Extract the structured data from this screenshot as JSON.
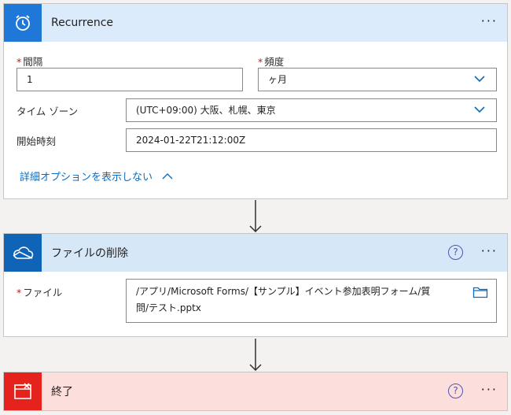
{
  "recurrence": {
    "title": "Recurrence",
    "more": "···",
    "header_color": "#dcebfc",
    "icon_bg": "#1f77d8",
    "icon": "alarm-clock-icon",
    "interval": {
      "label": "間隔",
      "value": "1"
    },
    "frequency": {
      "label": "頻度",
      "value": "ヶ月"
    },
    "timezone": {
      "label": "タイム ゾーン",
      "value": "(UTC+09:00) 大阪、札幌、東京"
    },
    "start_time": {
      "label": "開始時刻",
      "value": "2024-01-22T21:12:00Z"
    },
    "advanced_link": "詳細オプションを表示しない"
  },
  "delete_file": {
    "title": "ファイルの削除",
    "more": "···",
    "help": "?",
    "header_color": "#d6e7f7",
    "icon_bg": "#0f64b8",
    "icon": "onedrive-cloud-icon",
    "file": {
      "label": "ファイル",
      "value_line1": "/アプリ/Microsoft Forms/【サンプル】イベント参加表明フォーム/質",
      "value_line2": "問/テスト.pptx"
    }
  },
  "terminate": {
    "title": "終了",
    "more": "···",
    "help": "?",
    "header_color": "#fcdedc",
    "icon_bg": "#e5221b",
    "icon": "terminate-icon"
  },
  "colors": {
    "accent": "#0f6cbd",
    "required": "#a4262c",
    "help": "#4a57b8"
  }
}
